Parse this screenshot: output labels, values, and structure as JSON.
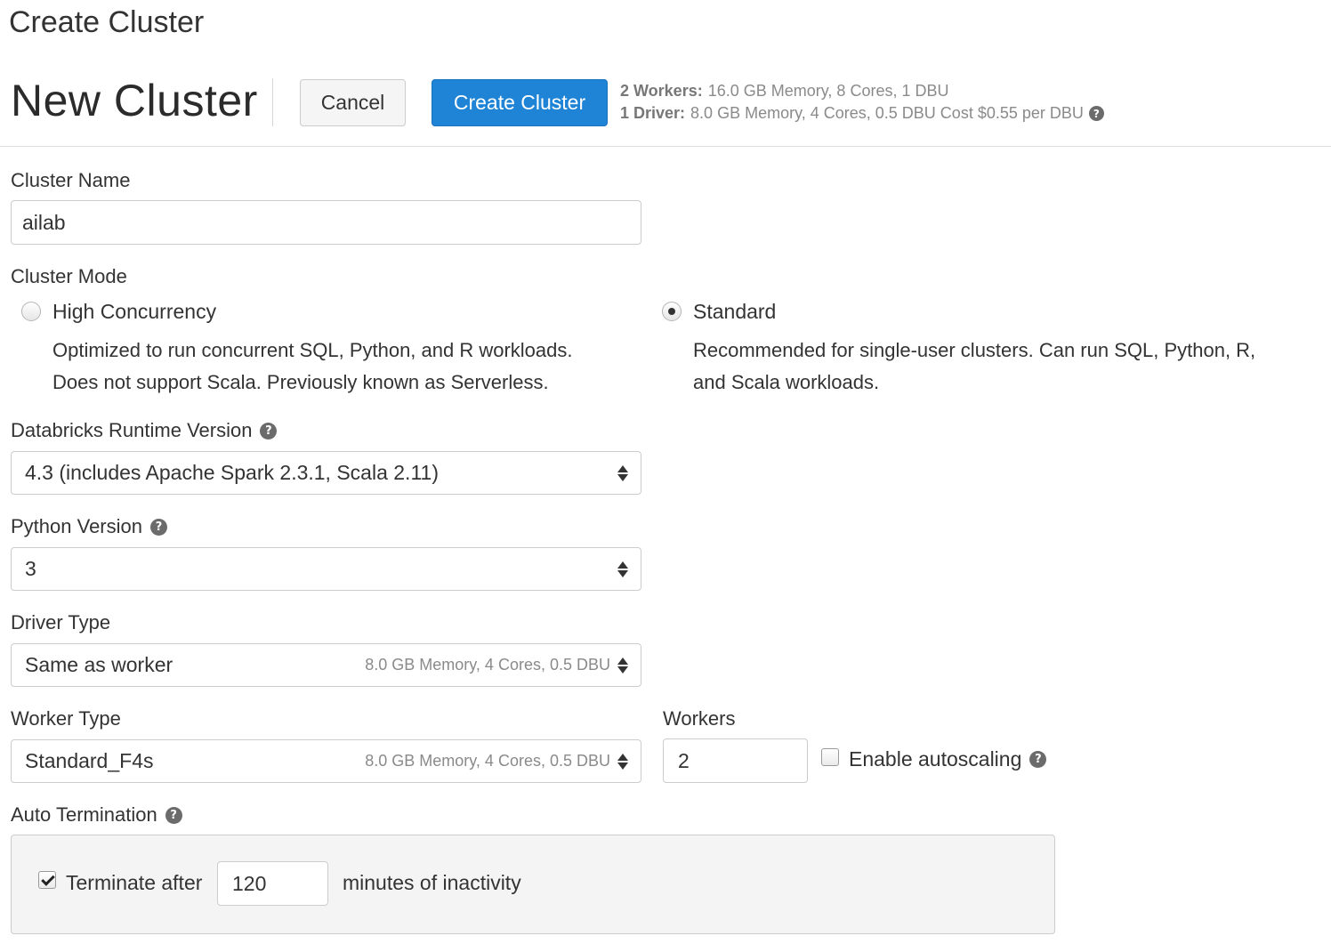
{
  "page_title": "Create Cluster",
  "header": {
    "heading": "New Cluster",
    "cancel_label": "Cancel",
    "create_label": "Create Cluster",
    "workers_key": "2 Workers:",
    "workers_value": "16.0 GB Memory, 8 Cores, 1 DBU",
    "driver_key": "1 Driver:",
    "driver_value": "8.0 GB Memory, 4 Cores, 0.5 DBU Cost $0.55 per DBU"
  },
  "form": {
    "cluster_name": {
      "label": "Cluster Name",
      "value": "ailab"
    },
    "cluster_mode": {
      "label": "Cluster Mode",
      "options": [
        {
          "label": "High Concurrency",
          "selected": false,
          "desc_1": "Optimized to run concurrent SQL, Python, and R workloads.",
          "desc_2": "Does not support Scala. Previously known as Serverless."
        },
        {
          "label": "Standard",
          "selected": true,
          "desc_1": "Recommended for single-user clusters. Can run SQL, Python, R,",
          "desc_2": "and Scala workloads."
        }
      ]
    },
    "runtime_version": {
      "label": "Databricks Runtime Version",
      "value": "4.3 (includes Apache Spark 2.3.1, Scala 2.11)"
    },
    "python_version": {
      "label": "Python Version",
      "value": "3"
    },
    "driver_type": {
      "label": "Driver Type",
      "value": "Same as worker",
      "meta": "8.0 GB Memory, 4 Cores, 0.5 DBU"
    },
    "worker_type": {
      "label": "Worker Type",
      "value": "Standard_F4s",
      "meta": "8.0 GB Memory, 4 Cores, 0.5 DBU"
    },
    "workers": {
      "label": "Workers",
      "value": "2"
    },
    "autoscaling": {
      "label": "Enable autoscaling",
      "checked": false
    },
    "auto_termination": {
      "label": "Auto Termination",
      "checkbox_label": "Terminate after",
      "checked": true,
      "minutes": "120",
      "suffix": "minutes of inactivity"
    }
  },
  "icons": {
    "help": "question-circle-icon",
    "select": "sort-arrows-icon",
    "help_glyph": "?"
  },
  "colors": {
    "primary_button": "#1f84d6",
    "border": "#cccccc",
    "muted_text": "#8a8a8a",
    "panel_bg": "#f4f4f4"
  }
}
